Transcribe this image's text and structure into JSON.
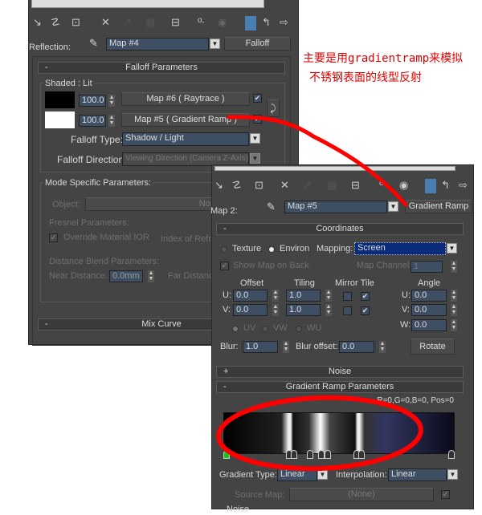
{
  "annotation": {
    "line1": "主要是用gradientramp来模拟",
    "line2": "不锈钢表面的线型反射",
    "color": "#e00000"
  },
  "toolbar_icons": [
    "get-material-icon",
    "put-to-scene-icon",
    "assign-material-icon",
    "delete-icon",
    "make-unique-icon",
    "put-to-library-icon",
    "material-effects-channel-icon",
    "show-map-icon",
    "show-end-result-icon",
    "go-to-parent-icon",
    "go-forward-icon"
  ],
  "left": {
    "reflection_label": "Reflection:",
    "map_name": "Map #4",
    "map_type": "Falloff",
    "falloff_header": "Falloff Parameters",
    "collapse": "-",
    "shaded_lit": "Shaded : Lit",
    "rows": [
      {
        "amount": "100.0",
        "map": "Map #6  ( Raytrace )",
        "color": "#000000",
        "enabled": true
      },
      {
        "amount": "100.0",
        "map": "Map #5  ( Gradient Ramp )",
        "color": "#ffffff",
        "enabled": true
      }
    ],
    "falloff_type_label": "Falloff Type:",
    "falloff_type": "Shadow / Light",
    "falloff_direction_label": "Falloff Direction:",
    "falloff_direction": "Viewing Direction (Camera Z-Axis)",
    "mode_specific": "Mode Specific Parameters:",
    "object_label": "Object:",
    "object_value": "None",
    "fresnel": "Fresnel Parameters:",
    "override_ior": "Override Material IOR",
    "ior_label": "Index of Refra",
    "distance_blend": "Distance Blend Parameters:",
    "near_label": "Near Distance:",
    "near_value": "0.0mm",
    "far_label": "Far Distance",
    "mix_curve": "Mix Curve"
  },
  "right": {
    "map_label": "Map 2:",
    "map_name": "Map #5",
    "map_type": "Gradient Ramp",
    "coordinates": "Coordinates",
    "texture": "Texture",
    "environ": "Environ",
    "selected_mode": "Environ",
    "mapping_label": "Mapping:",
    "mapping": "Screen",
    "show_map_on_back": "Show Map on Back",
    "map_channel_label": "Map Channel:",
    "map_channel": "1",
    "offset": "Offset",
    "tiling": "Tiling",
    "mirror_tile": "Mirror Tile",
    "angle": "Angle",
    "u": "U:",
    "v": "V:",
    "w": "W:",
    "offset_u": "0.0",
    "offset_v": "0.0",
    "tiling_u": "1.0",
    "tiling_v": "1.0",
    "mirror_u": false,
    "mirror_v": false,
    "tile_u": true,
    "tile_v": true,
    "angle_u": "0.0",
    "angle_v": "0.0",
    "angle_w": "0.0",
    "uv": "UV",
    "vw": "VW",
    "wu": "WU",
    "blur_label": "Blur:",
    "blur": "1.0",
    "blur_offset_label": "Blur offset:",
    "blur_offset": "0.0",
    "rotate": "Rotate",
    "noise": "Noise",
    "expand": "+",
    "collapse": "-",
    "gradient_header": "Gradient Ramp Parameters",
    "status": "R=0,G=0,B=0, Pos=0",
    "flag_positions_percent": [
      0,
      28,
      30,
      37,
      42,
      45,
      58,
      60,
      100
    ],
    "gradient_type_label": "Gradient Type:",
    "gradient_type": "Linear",
    "interpolation_label": "Interpolation:",
    "interpolation": "Linear",
    "source_map_label": "Source Map:",
    "source_map": "(None)",
    "noise_partial": "Noise"
  }
}
